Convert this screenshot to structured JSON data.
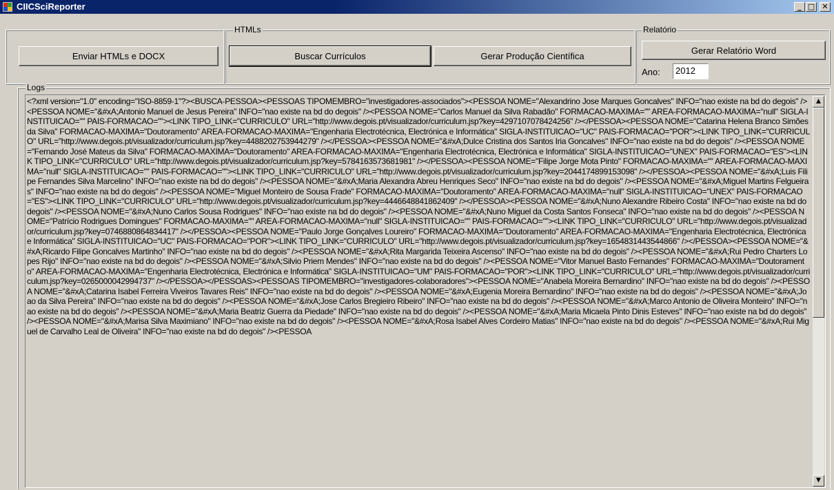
{
  "window": {
    "title": "CIICSciReporter",
    "minimize": "_",
    "maximize": "□",
    "close": "✕"
  },
  "buttons": {
    "enviar": "Enviar HTMLs e DOCX",
    "buscar": "Buscar Currículos",
    "gerar_producao": "Gerar Produção Científica",
    "gerar_relatorio": "Gerar Relatório Word"
  },
  "groups": {
    "htmls": "HTMLs",
    "relatorio": "Relatório",
    "logs": "Logs"
  },
  "ano": {
    "label": "Ano:",
    "value": "2012"
  },
  "logs": {
    "text": "<?xml version=\"1.0\" encoding=\"ISO-8859-1\"?><BUSCA-PESSOA><PESSOAS TIPOMEMBRO=\"investigadores-associados\"><PESSOA NOME=\"Alexandrino Jose Marques Goncalves\" INFO=\"nao existe na bd do degois\" /><PESSOA NOME=\"&#xA;Antonio Manuel de Jesus Pereira\" INFO=\"nao existe na bd do degois\" /><PESSOA NOME=\"Carlos Manuel da Silva Rabadão\" FORMACAO-MAXIMA=\"\" AREA-FORMACAO-MAXIMA=\"null\" SIGLA-INSTITUICAO=\"\" PAIS-FORMACAO=\"\"><LINK TIPO_LINK=\"CURRICULO\" URL=\"http://www.degois.pt/visualizador/curriculum.jsp?key=4297107078424256\" /></PESSOA><PESSOA NOME=\"Catarina Helena Branco Simões da Silva\" FORMACAO-MAXIMA=\"Doutoramento\" AREA-FORMACAO-MAXIMA=\"Engenharia Electrotécnica, Electrónica e Informática\" SIGLA-INSTITUICAO=\"UC\" PAIS-FORMACAO=\"POR\"><LINK TIPO_LINK=\"CURRICULO\" URL=\"http://www.degois.pt/visualizador/curriculum.jsp?key=4488202753944279\" /></PESSOA><PESSOA NOME=\"&#xA;Dulce Cristina dos Santos Iria Goncalves\" INFO=\"nao existe na bd do degois\" /><PESSOA NOME=\"Fernando José Mateus da Silva\" FORMACAO-MAXIMA=\"Doutoramento\" AREA-FORMACAO-MAXIMA=\"Engenharia Electrotécnica, Electrónica e Informática\" SIGLA-INSTITUICAO=\"UNEX\" PAIS-FORMACAO=\"ES\"><LINK TIPO_LINK=\"CURRICULO\" URL=\"http://www.degois.pt/visualizador/curriculum.jsp?key=5784163573681981\" /></PESSOA><PESSOA NOME=\"Filipe Jorge Mota Pinto\" FORMACAO-MAXIMA=\"\" AREA-FORMACAO-MAXIMA=\"null\" SIGLA-INSTITUICAO=\"\" PAIS-FORMACAO=\"\"><LINK TIPO_LINK=\"CURRICULO\" URL=\"http://www.degois.pt/visualizador/curriculum.jsp?key=2044174899153098\" /></PESSOA><PESSOA NOME=\"&#xA;Luis Filipe Fernandes Silva Marcelino\" INFO=\"nao existe na bd do degois\" /><PESSOA NOME=\"&#xA;Maria Alexandra Abreu Henriques Seco\" INFO=\"nao existe na bd do degois\" /><PESSOA NOME=\"&#xA;Miguel Martins Felgueiras\" INFO=\"nao existe na bd do degois\" /><PESSOA NOME=\"Miguel Monteiro de Sousa Frade\" FORMACAO-MAXIMA=\"Doutoramento\" AREA-FORMACAO-MAXIMA=\"null\" SIGLA-INSTITUICAO=\"UNEX\" PAIS-FORMACAO=\"ES\"><LINK TIPO_LINK=\"CURRICULO\" URL=\"http://www.degois.pt/visualizador/curriculum.jsp?key=4446648841862409\" /></PESSOA><PESSOA NOME=\"&#xA;Nuno Alexandre Ribeiro Costa\" INFO=\"nao existe na bd do degois\" /><PESSOA NOME=\"&#xA;Nuno Carlos Sousa Rodrigues\" INFO=\"nao existe na bd do degois\" /><PESSOA NOME=\"&#xA;Nuno Miguel da Costa Santos Fonseca\" INFO=\"nao existe na bd do degois\" /><PESSOA NOME=\"Patrício Rodrigues Domingues\" FORMACAO-MAXIMA=\"\" AREA-FORMACAO-MAXIMA=\"null\" SIGLA-INSTITUICAO=\"\" PAIS-FORMACAO=\"\"><LINK TIPO_LINK=\"CURRICULO\" URL=\"http://www.degois.pt/visualizador/curriculum.jsp?key=0746880864834417\" /></PESSOA><PESSOA NOME=\"Paulo Jorge Gonçalves Loureiro\" FORMACAO-MAXIMA=\"Doutoramento\" AREA-FORMACAO-MAXIMA=\"Engenharia Electrotécnica, Electrónica e Informática\" SIGLA-INSTITUICAO=\"UC\" PAIS-FORMACAO=\"POR\"><LINK TIPO_LINK=\"CURRICULO\" URL=\"http://www.degois.pt/visualizador/curriculum.jsp?key=1654831443544866\" /></PESSOA><PESSOA NOME=\"&#xA;Ricardo Filipe Goncalves Martinho\" INFO=\"nao existe na bd do degois\" /><PESSOA NOME=\"&#xA;Rita Margarida Teixeira Ascenso\" INFO=\"nao existe na bd do degois\" /><PESSOA NOME=\"&#xA;Rui Pedro Charters Lopes Rijo\" INFO=\"nao existe na bd do degois\" /><PESSOA NOME=\"&#xA;Silvio Priem Mendes\" INFO=\"nao existe na bd do degois\" /><PESSOA NOME=\"Vitor Manuel Basto Fernandes\" FORMACAO-MAXIMA=\"Doutoramento\" AREA-FORMACAO-MAXIMA=\"Engenharia Electrotécnica, Electrónica e Informática\" SIGLA-INSTITUICAO=\"UM\" PAIS-FORMACAO=\"POR\"><LINK TIPO_LINK=\"CURRICULO\" URL=\"http://www.degois.pt/visualizador/curriculum.jsp?key=0265000042994737\" /></PESSOA></PESSOAS><PESSOAS TIPOMEMBRO=\"investigadores-colaboradores\"><PESSOA NOME=\"Anabela Moreira Bernardino\" INFO=\"nao existe na bd do degois\" /><PESSOA NOME=\"&#xA;Catarina Isabel Ferreira Viveiros Tavares Reis\" INFO=\"nao existe na bd do degois\" /><PESSOA NOME=\"&#xA;Eugenia Moreira Bernardino\" INFO=\"nao existe na bd do degois\" /><PESSOA NOME=\"&#xA;Joao da Silva Pereira\" INFO=\"nao existe na bd do degois\" /><PESSOA NOME=\"&#xA;Jose Carlos Bregieiro Ribeiro\" INFO=\"nao existe na bd do degois\" /><PESSOA NOME=\"&#xA;Marco Antonio de Oliveira Monteiro\" INFO=\"nao existe na bd do degois\" /><PESSOA NOME=\"&#xA;Maria Beatriz Guerra da Piedade\" INFO=\"nao existe na bd do degois\" /><PESSOA NOME=\"&#xA;Maria Micaela Pinto Dinis Esteves\" INFO=\"nao existe na bd do degois\" /><PESSOA NOME=\"&#xA;Marisa Silva Maximiano\" INFO=\"nao existe na bd do degois\" /><PESSOA NOME=\"&#xA;Rosa Isabel Alves Cordeiro Matias\" INFO=\"nao existe na bd do degois\" /><PESSOA NOME=\"&#xA;Rui Miguel de Carvalho Leal de Oliveira\" INFO=\"nao existe na bd do degois\" /><PESSOA"
  },
  "scrollbar": {
    "up": "▲",
    "down": "▼"
  }
}
